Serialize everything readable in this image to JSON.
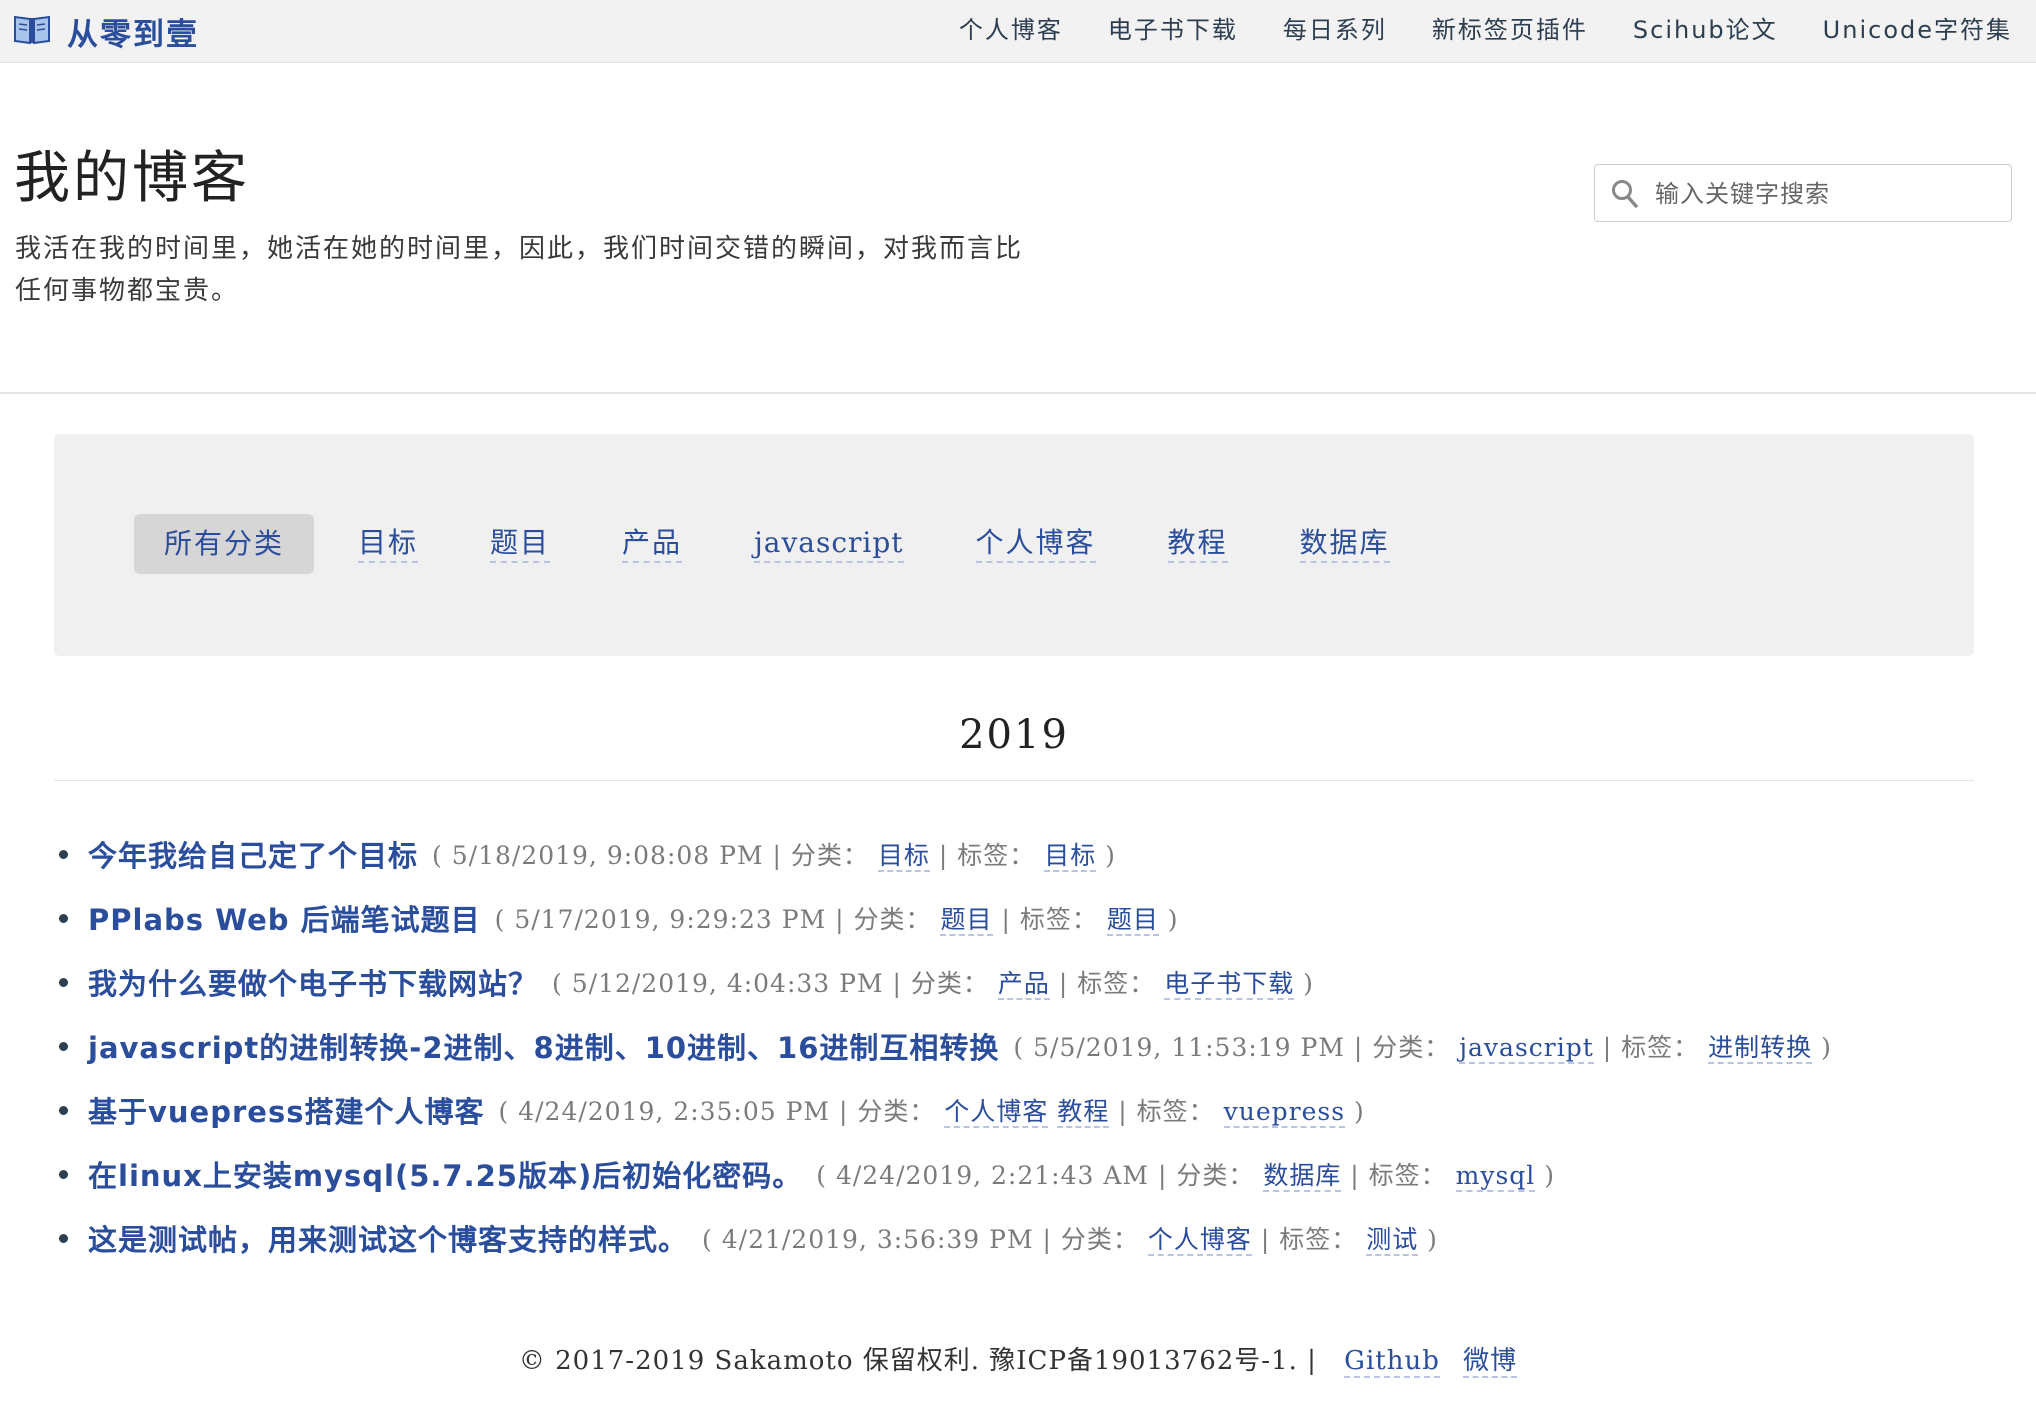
{
  "brand": {
    "title": "从零到壹",
    "icon": "open-book-icon"
  },
  "nav": [
    "个人博客",
    "电子书下载",
    "每日系列",
    "新标签页插件",
    "Scihub论文",
    "Unicode字符集"
  ],
  "header": {
    "title": "我的博客",
    "description": "我活在我的时间里，她活在她的时间里，因此，我们时间交错的瞬间，对我而言比任何事物都宝贵。"
  },
  "search": {
    "placeholder": "输入关键字搜索",
    "value": ""
  },
  "categories": {
    "active": "所有分类",
    "items": [
      "所有分类",
      "目标",
      "题目",
      "产品",
      "javascript",
      "个人博客",
      "教程",
      "数据库"
    ]
  },
  "year": "2019",
  "posts": [
    {
      "title": "今年我给自己定了个目标",
      "date": "5/18/2019, 9:08:08 PM",
      "categories": [
        "目标"
      ],
      "tags": [
        "目标"
      ]
    },
    {
      "title": "PPlabs Web 后端笔试题目",
      "date": "5/17/2019, 9:29:23 PM",
      "categories": [
        "题目"
      ],
      "tags": [
        "题目"
      ]
    },
    {
      "title": "我为什么要做个电子书下载网站？",
      "date": "5/12/2019, 4:04:33 PM",
      "categories": [
        "产品"
      ],
      "tags": [
        "电子书下载"
      ]
    },
    {
      "title": "javascript的进制转换-2进制、8进制、10进制、16进制互相转换",
      "date": "5/5/2019, 11:53:19 PM",
      "categories": [
        "javascript"
      ],
      "tags": [
        "进制转换"
      ]
    },
    {
      "title": "基于vuepress搭建个人博客",
      "date": "4/24/2019, 2:35:05 PM",
      "categories": [
        "个人博客",
        "教程"
      ],
      "tags": [
        "vuepress"
      ]
    },
    {
      "title": "在linux上安装mysql(5.7.25版本)后初始化密码。",
      "date": "4/24/2019, 2:21:43 AM",
      "categories": [
        "数据库"
      ],
      "tags": [
        "mysql"
      ]
    },
    {
      "title": "这是测试帖，用来测试这个博客支持的样式。",
      "date": "4/21/2019, 3:56:39 PM",
      "categories": [
        "个人博客"
      ],
      "tags": [
        "测试"
      ]
    }
  ],
  "labels": {
    "category": "分类：",
    "tag": "标签：",
    "open": "(",
    "close": ")",
    "sep": "|"
  },
  "footer": {
    "copyright": "© 2017-2019 Sakamoto 保留权利. 豫ICP备19013762号-1. |",
    "links": [
      "Github",
      "微博"
    ]
  },
  "colors": {
    "link": "#2a4d9c",
    "meta": "#7b7b7b",
    "topbar": "#f2f2f2",
    "panel": "#f0f0f0"
  }
}
